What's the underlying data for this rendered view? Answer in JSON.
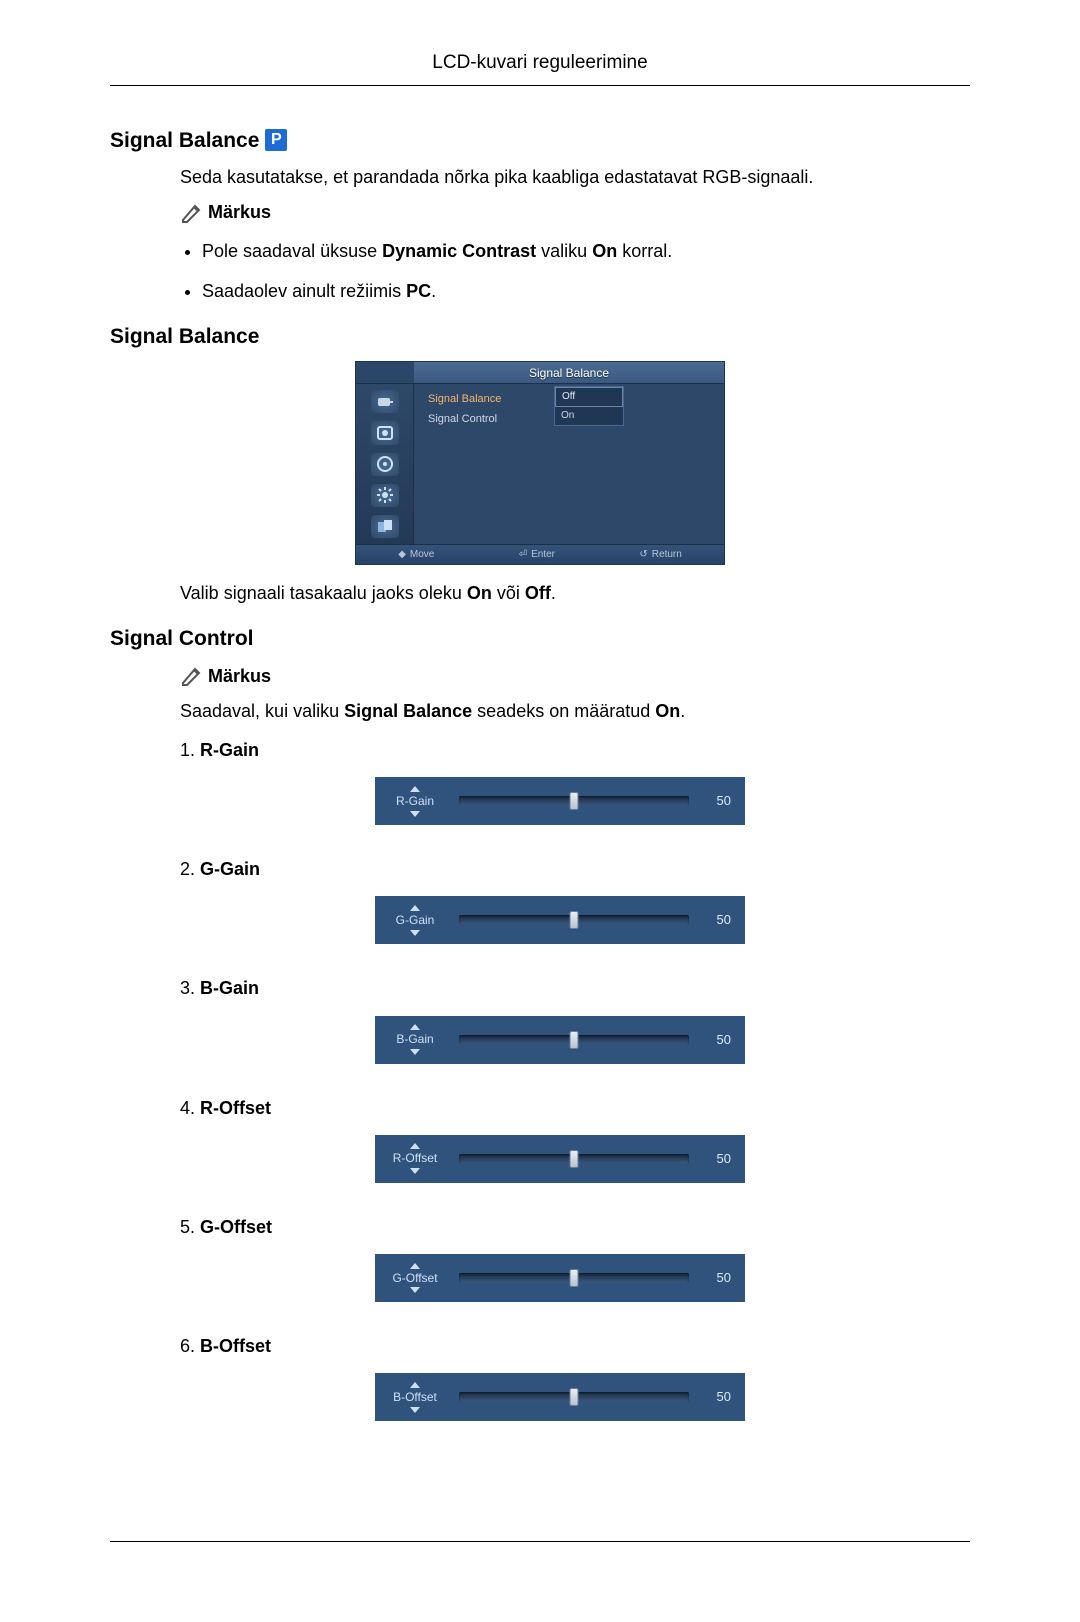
{
  "header": {
    "title": "LCD-kuvari reguleerimine"
  },
  "s1": {
    "heading": "Signal Balance",
    "intro": "Seda kasutatakse, et parandada nõrka pika kaabliga edastatavat RGB-signaali.",
    "note_label": "Märkus",
    "bullets": {
      "b1_pre": "Pole saadaval üksuse ",
      "b1_bold1": "Dynamic Contrast",
      "b1_mid": " valiku ",
      "b1_bold2": "On",
      "b1_post": " korral.",
      "b2_pre": "Saadaolev ainult režiimis ",
      "b2_bold": "PC",
      "b2_post": "."
    }
  },
  "s2": {
    "heading": "Signal Balance",
    "osd": {
      "title": "Signal Balance",
      "row1": "Signal Balance",
      "row2": "Signal Control",
      "opt_off": "Off",
      "opt_on": "On",
      "foot_move": "Move",
      "foot_enter": "Enter",
      "foot_return": "Return"
    },
    "desc_pre": "Valib signaali tasakaalu jaoks oleku ",
    "desc_b1": "On",
    "desc_mid": " või ",
    "desc_b2": "Off",
    "desc_post": "."
  },
  "s3": {
    "heading": "Signal Control",
    "note_label": "Märkus",
    "avail_pre": "Saadaval, kui valiku ",
    "avail_b1": "Signal Balance",
    "avail_mid": " seadeks on määratud ",
    "avail_b2": "On",
    "avail_post": ".",
    "sliders": [
      {
        "label": "R-Gain",
        "name": "R-Gain",
        "value": 50
      },
      {
        "label": "G-Gain",
        "name": "G-Gain",
        "value": 50
      },
      {
        "label": "B-Gain",
        "name": "B-Gain",
        "value": 50
      },
      {
        "label": "R-Offset",
        "name": "R-Offset",
        "value": 50
      },
      {
        "label": "G-Offset",
        "name": "G-Offset",
        "value": 50
      },
      {
        "label": "B-Offset",
        "name": "B-Offset",
        "value": 50
      }
    ]
  }
}
